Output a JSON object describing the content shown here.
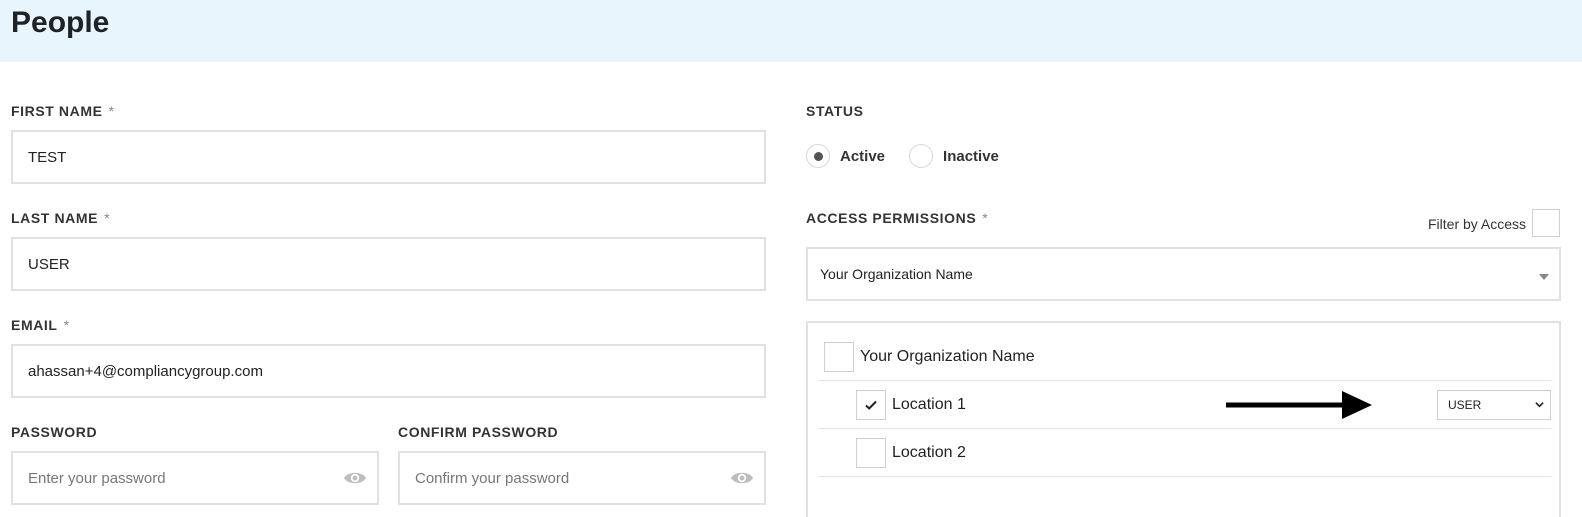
{
  "header": {
    "title": "People"
  },
  "form": {
    "first_name": {
      "label": "FIRST NAME",
      "required": "*",
      "value": "TEST"
    },
    "last_name": {
      "label": "LAST NAME",
      "required": "*",
      "value": "USER"
    },
    "email": {
      "label": "EMAIL",
      "required": "*",
      "value": "ahassan+4@compliancygroup.com"
    },
    "password": {
      "label": "PASSWORD",
      "placeholder": "Enter your password",
      "icon": "eye-icon"
    },
    "confirm_password": {
      "label": "CONFIRM PASSWORD",
      "placeholder": "Confirm your password",
      "icon": "eye-icon"
    }
  },
  "status": {
    "label": "STATUS",
    "options": [
      {
        "label": "Active",
        "selected": true
      },
      {
        "label": "Inactive",
        "selected": false
      }
    ]
  },
  "access": {
    "label": "ACCESS PERMISSIONS",
    "required": "*",
    "filter_label": "Filter by Access",
    "filter_checked": false,
    "organization_select": "Your Organization Name",
    "tree": [
      {
        "label": "Your Organization Name",
        "checked": false,
        "level": 0
      },
      {
        "label": "Location 1",
        "checked": true,
        "level": 1,
        "role": "USER"
      },
      {
        "label": "Location 2",
        "checked": false,
        "level": 1
      }
    ]
  },
  "colors": {
    "header_bg": "#e8f5fc",
    "border": "#e1e1e1",
    "arrow": "#000000"
  }
}
